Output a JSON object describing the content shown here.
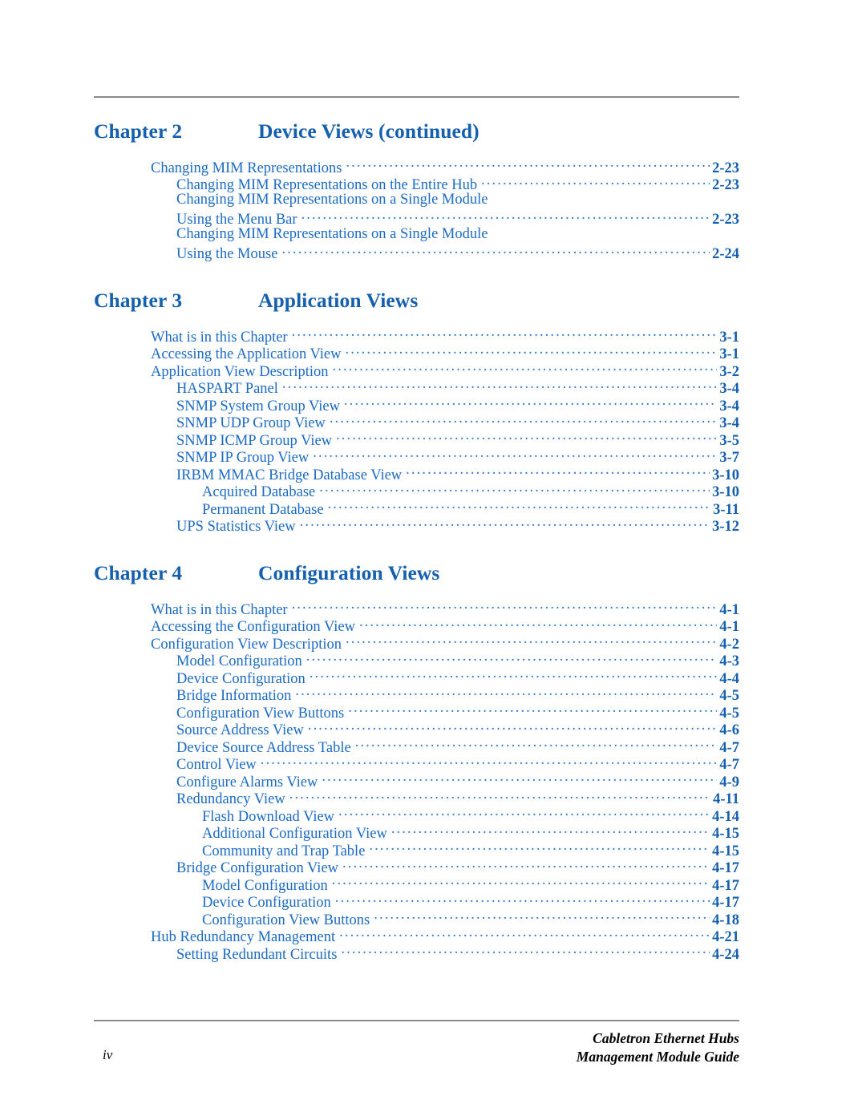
{
  "colors": {
    "heading_blue": "#1560AE",
    "entry_blue": "#1C6BC4",
    "leader_blue": "#2A78CE",
    "rule_gray": "#8A8A8A",
    "footer_black": "#000000"
  },
  "chapters": [
    {
      "label": "Chapter 2",
      "title": "Device Views (continued)",
      "entries": [
        {
          "level": 1,
          "text": "Changing MIM Representations",
          "page": "2-23",
          "continuation": false
        },
        {
          "level": 2,
          "text": "Changing MIM Representations on the Entire Hub",
          "page": "2-23",
          "continuation": false
        },
        {
          "level": 2,
          "text": "Changing MIM Representations on a Single Module",
          "page": "",
          "continuation": true
        },
        {
          "level": 2,
          "text": "Using the Menu Bar",
          "page": "2-23",
          "continuation": false
        },
        {
          "level": 2,
          "text": "Changing MIM Representations on a Single Module",
          "page": "",
          "continuation": true
        },
        {
          "level": 2,
          "text": "Using the Mouse",
          "page": "2-24",
          "continuation": false
        }
      ]
    },
    {
      "label": "Chapter 3",
      "title": "Application Views",
      "entries": [
        {
          "level": 1,
          "text": "What is in this Chapter",
          "page": "3-1",
          "continuation": false
        },
        {
          "level": 1,
          "text": "Accessing the Application View",
          "page": "3-1",
          "continuation": false
        },
        {
          "level": 1,
          "text": "Application View Description",
          "page": "3-2",
          "continuation": false
        },
        {
          "level": 2,
          "text": "HASPART Panel",
          "page": "3-4",
          "continuation": false
        },
        {
          "level": 2,
          "text": "SNMP System Group View",
          "page": "3-4",
          "continuation": false
        },
        {
          "level": 2,
          "text": "SNMP UDP Group View",
          "page": "3-4",
          "continuation": false
        },
        {
          "level": 2,
          "text": "SNMP ICMP Group View",
          "page": "3-5",
          "continuation": false
        },
        {
          "level": 2,
          "text": "SNMP IP Group View",
          "page": "3-7",
          "continuation": false
        },
        {
          "level": 2,
          "text": "IRBM MMAC Bridge Database View",
          "page": "3-10",
          "continuation": false
        },
        {
          "level": 3,
          "text": "Acquired Database",
          "page": "3-10",
          "continuation": false
        },
        {
          "level": 3,
          "text": "Permanent Database",
          "page": "3-11",
          "continuation": false
        },
        {
          "level": 2,
          "text": "UPS Statistics View",
          "page": "3-12",
          "continuation": false
        }
      ]
    },
    {
      "label": "Chapter 4",
      "title": "Configuration Views",
      "entries": [
        {
          "level": 1,
          "text": "What is in this Chapter",
          "page": "4-1",
          "continuation": false
        },
        {
          "level": 1,
          "text": "Accessing the Configuration View",
          "page": "4-1",
          "continuation": false
        },
        {
          "level": 1,
          "text": "Configuration View Description",
          "page": "4-2",
          "continuation": false
        },
        {
          "level": 2,
          "text": "Model Configuration",
          "page": "4-3",
          "continuation": false
        },
        {
          "level": 2,
          "text": "Device Configuration",
          "page": "4-4",
          "continuation": false
        },
        {
          "level": 2,
          "text": "Bridge Information",
          "page": "4-5",
          "continuation": false
        },
        {
          "level": 2,
          "text": "Configuration View Buttons",
          "page": "4-5",
          "continuation": false
        },
        {
          "level": 2,
          "text": "Source Address View",
          "page": "4-6",
          "continuation": false
        },
        {
          "level": 2,
          "text": "Device Source Address Table",
          "page": "4-7",
          "continuation": false
        },
        {
          "level": 2,
          "text": "Control View",
          "page": "4-7",
          "continuation": false
        },
        {
          "level": 2,
          "text": "Configure Alarms View",
          "page": "4-9",
          "continuation": false
        },
        {
          "level": 2,
          "text": "Redundancy View",
          "page": "4-11",
          "continuation": false
        },
        {
          "level": 3,
          "text": "Flash Download View",
          "page": "4-14",
          "continuation": false
        },
        {
          "level": 3,
          "text": "Additional Configuration View",
          "page": "4-15",
          "continuation": false
        },
        {
          "level": 3,
          "text": "Community and Trap Table",
          "page": "4-15",
          "continuation": false
        },
        {
          "level": 2,
          "text": "Bridge Configuration View",
          "page": "4-17",
          "continuation": false
        },
        {
          "level": 3,
          "text": "Model Configuration",
          "page": "4-17",
          "continuation": false
        },
        {
          "level": 3,
          "text": "Device Configuration",
          "page": "4-17",
          "continuation": false
        },
        {
          "level": 3,
          "text": "Configuration View Buttons",
          "page": "4-18",
          "continuation": false
        },
        {
          "level": 1,
          "text": "Hub Redundancy Management",
          "page": "4-21",
          "continuation": false
        },
        {
          "level": 2,
          "text": "Setting Redundant Circuits",
          "page": "4-24",
          "continuation": false
        }
      ]
    }
  ],
  "footer": {
    "folio": "iv",
    "doc_title_line1": "Cabletron Ethernet Hubs",
    "doc_title_line2": "Management Module Guide"
  }
}
